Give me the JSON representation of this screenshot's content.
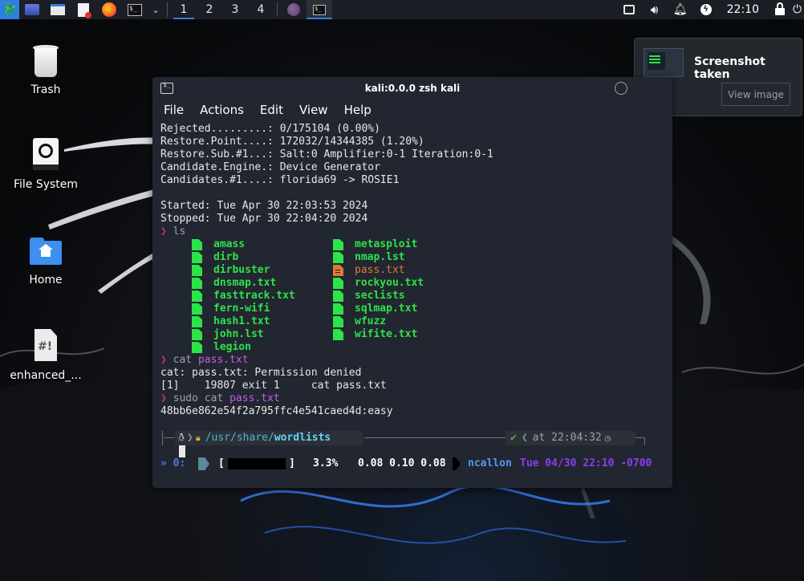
{
  "panel": {
    "workspaces": [
      "1",
      "2",
      "3",
      "4"
    ],
    "clock": "22:10"
  },
  "desktop_icons": [
    {
      "label": "Trash"
    },
    {
      "label": "File System"
    },
    {
      "label": "Home"
    },
    {
      "label": "enhanced_..."
    }
  ],
  "notification": {
    "title": "Screenshot taken",
    "button": "View image"
  },
  "terminal": {
    "title": "kali:0.0.0 zsh kali",
    "menu": [
      "File",
      "Actions",
      "Edit",
      "View",
      "Help"
    ],
    "output_lines": [
      "Rejected.........: 0/175104 (0.00%)",
      "Restore.Point....: 172032/14344385 (1.20%)",
      "Restore.Sub.#1...: Salt:0 Amplifier:0-1 Iteration:0-1",
      "Candidate.Engine.: Device Generator",
      "Candidates.#1....: florida69 -> ROSIE1",
      "",
      "Started: Tue Apr 30 22:03:53 2024",
      "Stopped: Tue Apr 30 22:04:20 2024"
    ],
    "prompt_symbol": "❯",
    "cmd1": "ls",
    "ls_col1": [
      "amass",
      "dirb",
      "dirbuster",
      "dnsmap.txt",
      "fasttrack.txt",
      "fern-wifi",
      "hash1.txt",
      "john.lst",
      "legion"
    ],
    "ls_col2": [
      "metasploit",
      "nmap.lst",
      "pass.txt",
      "rockyou.txt",
      "seclists",
      "sqlmap.txt",
      "wfuzz",
      "wifite.txt"
    ],
    "cmd2": {
      "cmd": "cat",
      "arg": "pass.txt"
    },
    "cat_error": "cat: pass.txt: Permission denied",
    "exit_line": "[1]    19807 exit 1     cat pass.txt",
    "cmd3": {
      "cmd": "sudo cat",
      "arg": "pass.txt"
    },
    "hash_result": "48bb6e862e54f2a795ffc4e541caed4d:easy",
    "path": {
      "root": "/",
      "p1": "usr",
      "p2": "share",
      "p3": "wordlists"
    },
    "status_check": "✔",
    "status_time": "at 22:04:32"
  },
  "tmux": {
    "session": "» 0:",
    "bar_left": "[",
    "bar_right": "]",
    "cpu": "3.3%",
    "load": "0.08 0.10 0.08",
    "user": "ncallon",
    "datetime": "Tue 04/30 22:10 -0700"
  },
  "colors": {
    "accent": "#2f7fe0",
    "ls_green": "#2ce34a",
    "prompt_pink": "#d62e73",
    "arg_purple": "#c35fe0",
    "path_cyan": "#4fb7d0",
    "tmux_blue": "#4f7ee0",
    "tmux_purple": "#8a3ef0"
  }
}
